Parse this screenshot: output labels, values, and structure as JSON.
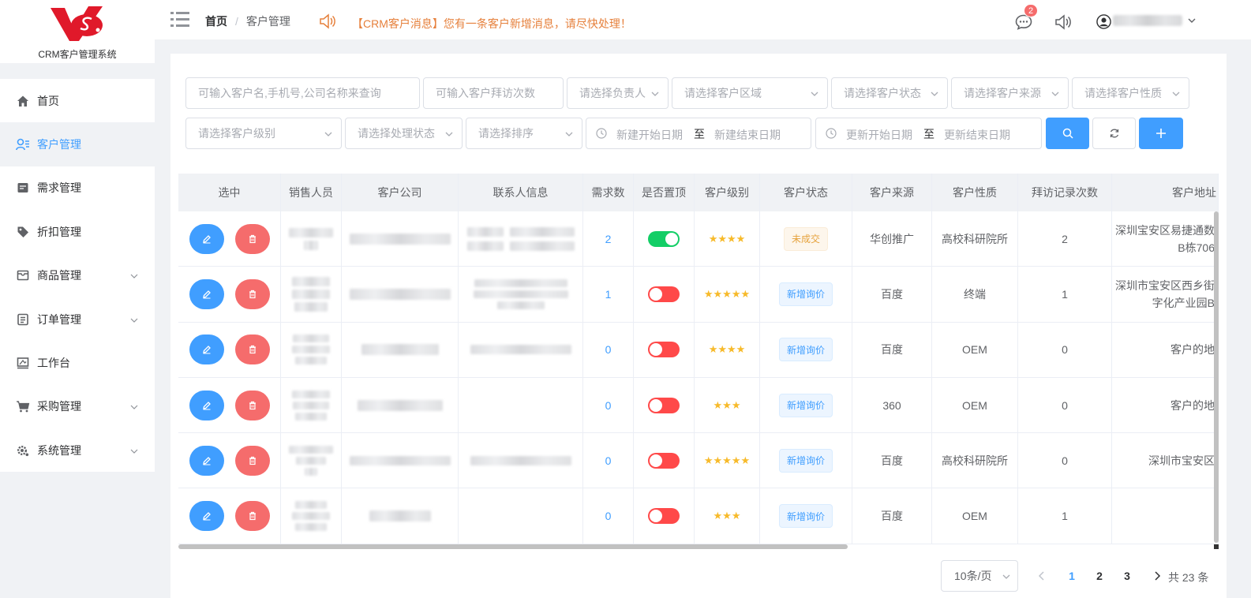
{
  "app": {
    "title": "CRM客户管理系统",
    "accent": "#409eff",
    "danger": "#f56c6c",
    "logo_color": "#e0192a"
  },
  "sidebar": {
    "items": [
      {
        "label": "首页",
        "icon": "home-icon",
        "active": false,
        "expandable": false
      },
      {
        "label": "客户管理",
        "icon": "user-list-icon",
        "active": true,
        "expandable": false
      },
      {
        "label": "需求管理",
        "icon": "document-icon",
        "active": false,
        "expandable": false
      },
      {
        "label": "折扣管理",
        "icon": "tag-icon",
        "active": false,
        "expandable": false
      },
      {
        "label": "商品管理",
        "icon": "box-icon",
        "active": false,
        "expandable": true
      },
      {
        "label": "订单管理",
        "icon": "order-icon",
        "active": false,
        "expandable": true
      },
      {
        "label": "工作台",
        "icon": "desk-icon",
        "active": false,
        "expandable": false
      },
      {
        "label": "采购管理",
        "icon": "cart-icon",
        "active": false,
        "expandable": true
      },
      {
        "label": "系统管理",
        "icon": "gear-icon",
        "active": false,
        "expandable": true
      }
    ]
  },
  "header": {
    "breadcrumb_home": "首页",
    "breadcrumb_sep": "/",
    "breadcrumb_current": "客户管理",
    "notice": "【CRM客户消息】您有一条客户新增消息，请尽快处理！",
    "message_count": "2"
  },
  "filters": {
    "search_placeholder": "可输入客户名,手机号,公司名称来查询",
    "visit_placeholder": "可输入客户拜访次数",
    "owner_placeholder": "请选择负责人",
    "region_placeholder": "请选择客户区域",
    "status_placeholder": "请选择客户状态",
    "source_placeholder": "请选择客户来源",
    "nature_placeholder": "请选择客户性质",
    "level_placeholder": "请选择客户级别",
    "process_placeholder": "请选择处理状态",
    "sort_placeholder": "请选择排序",
    "create_start": "新建开始日期",
    "create_end": "新建结束日期",
    "update_start": "更新开始日期",
    "update_end": "更新结束日期",
    "range_to": "至"
  },
  "table": {
    "headers": [
      "选中",
      "销售人员",
      "客户公司",
      "联系人信息",
      "需求数",
      "是否置顶",
      "客户级别",
      "客户状态",
      "客户来源",
      "客户性质",
      "拜访记录次数",
      "客户地址"
    ],
    "rows": [
      {
        "demand": "2",
        "pinned": true,
        "stars": "★★★★",
        "status": "未成交",
        "status_type": "warn",
        "source": "华创推广",
        "nature": "高校科研院所",
        "visits": "2",
        "address": "深圳宝安区易捷通数\nB栋706"
      },
      {
        "demand": "1",
        "pinned": false,
        "stars": "★★★★★",
        "status": "新增询价",
        "status_type": "info",
        "source": "百度",
        "nature": "终端",
        "visits": "1",
        "address": "深圳市宝安区西乡街\n字化产业园B"
      },
      {
        "demand": "0",
        "pinned": false,
        "stars": "★★★★",
        "status": "新增询价",
        "status_type": "info",
        "source": "百度",
        "nature": "OEM",
        "visits": "0",
        "address": "客户的地"
      },
      {
        "demand": "0",
        "pinned": false,
        "stars": "★★★",
        "status": "新增询价",
        "status_type": "info",
        "source": "360",
        "nature": "OEM",
        "visits": "0",
        "address": "客户的地"
      },
      {
        "demand": "0",
        "pinned": false,
        "stars": "★★★★★",
        "status": "新增询价",
        "status_type": "info",
        "source": "百度",
        "nature": "高校科研院所",
        "visits": "0",
        "address": "深圳市宝安区"
      },
      {
        "demand": "0",
        "pinned": false,
        "stars": "★★★",
        "status": "新增询价",
        "status_type": "info",
        "source": "百度",
        "nature": "OEM",
        "visits": "1",
        "address": ""
      }
    ]
  },
  "pagination": {
    "page_size": "10条/页",
    "pages": [
      "1",
      "2",
      "3"
    ],
    "current": "1",
    "total": "共 23 条"
  }
}
